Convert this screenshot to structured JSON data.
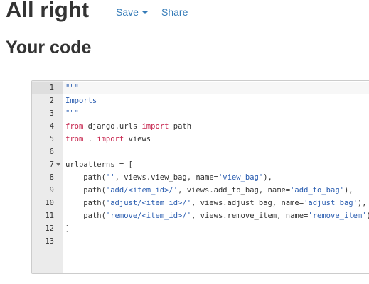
{
  "header": {
    "title": "All right",
    "save_label": "Save",
    "share_label": "Share"
  },
  "section": {
    "title": "Your code"
  },
  "editor": {
    "active_line": 1,
    "fold_line": 7,
    "line_numbers": [
      "1",
      "2",
      "3",
      "4",
      "5",
      "6",
      "7",
      "8",
      "9",
      "10",
      "11",
      "12",
      "13"
    ],
    "lines": [
      [
        {
          "t": "\"\"\"",
          "c": "doc"
        }
      ],
      [
        {
          "t": "Imports",
          "c": "doc"
        }
      ],
      [
        {
          "t": "\"\"\"",
          "c": "doc"
        }
      ],
      [
        {
          "t": "from",
          "c": "kw"
        },
        {
          "t": " django.urls ",
          "c": "nm"
        },
        {
          "t": "import",
          "c": "kw"
        },
        {
          "t": " path",
          "c": "nm"
        }
      ],
      [
        {
          "t": "from",
          "c": "kw"
        },
        {
          "t": " . ",
          "c": "nm"
        },
        {
          "t": "import",
          "c": "kw"
        },
        {
          "t": " views",
          "c": "nm"
        }
      ],
      [],
      [
        {
          "t": "urlpatterns = [",
          "c": "nm"
        }
      ],
      [
        {
          "t": "    path(",
          "c": "nm"
        },
        {
          "t": "''",
          "c": "str"
        },
        {
          "t": ", views.view_bag, name=",
          "c": "nm"
        },
        {
          "t": "'view_bag'",
          "c": "str"
        },
        {
          "t": "),",
          "c": "nm"
        }
      ],
      [
        {
          "t": "    path(",
          "c": "nm"
        },
        {
          "t": "'add/<item_id>/'",
          "c": "str"
        },
        {
          "t": ", views.add_to_bag, name=",
          "c": "nm"
        },
        {
          "t": "'add_to_bag'",
          "c": "str"
        },
        {
          "t": "),",
          "c": "nm"
        }
      ],
      [
        {
          "t": "    path(",
          "c": "nm"
        },
        {
          "t": "'adjust/<item_id>/'",
          "c": "str"
        },
        {
          "t": ", views.adjust_bag, name=",
          "c": "nm"
        },
        {
          "t": "'adjust_bag'",
          "c": "str"
        },
        {
          "t": "),",
          "c": "nm"
        }
      ],
      [
        {
          "t": "    path(",
          "c": "nm"
        },
        {
          "t": "'remove/<item_id>/'",
          "c": "str"
        },
        {
          "t": ", views.remove_item, name=",
          "c": "nm"
        },
        {
          "t": "'remove_item'",
          "c": "str"
        },
        {
          "t": "),",
          "c": "nm"
        }
      ],
      [
        {
          "t": "]",
          "c": "nm"
        }
      ],
      []
    ]
  }
}
